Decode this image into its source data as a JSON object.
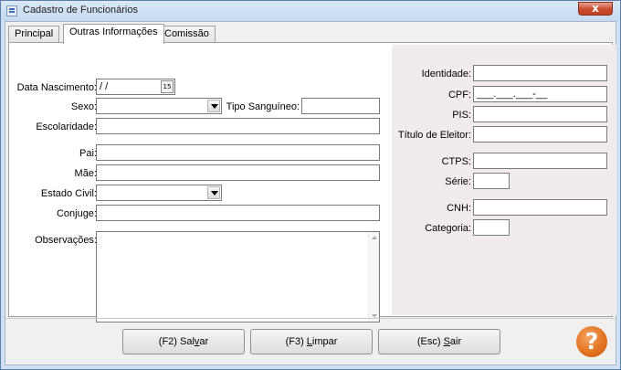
{
  "window": {
    "title": "Cadastro de Funcionários",
    "close_symbol": "x"
  },
  "tabs": [
    {
      "label": "Principal"
    },
    {
      "label": "Outras Informações",
      "active": true
    },
    {
      "label": "Comissão"
    }
  ],
  "form": {
    "data_nascimento": {
      "label": "Data Nascimento:",
      "value": " /  /",
      "calendar_glyph": "15"
    },
    "sexo": {
      "label": "Sexo:",
      "value": ""
    },
    "tipo_sanguineo": {
      "label": "Tipo Sanguíneo:",
      "value": ""
    },
    "escolaridade": {
      "label": "Escolaridade:",
      "value": ""
    },
    "pai": {
      "label": "Pai:",
      "value": ""
    },
    "mae": {
      "label": "Mãe:",
      "value": ""
    },
    "estado_civil": {
      "label": "Estado Civil:",
      "value": ""
    },
    "conjuge": {
      "label": "Conjuge:",
      "value": ""
    },
    "observacoes": {
      "label": "Observações:",
      "value": ""
    }
  },
  "docs": {
    "identidade": {
      "label": "Identidade:",
      "value": ""
    },
    "cpf": {
      "label": "CPF:",
      "value": "___.___.___-__"
    },
    "pis": {
      "label": "PIS:",
      "value": ""
    },
    "titulo_eleitor": {
      "label": "Título de Eleitor:",
      "value": ""
    },
    "ctps": {
      "label": "CTPS:",
      "value": ""
    },
    "serie": {
      "label": "Série:",
      "value": ""
    },
    "cnh": {
      "label": "CNH:",
      "value": ""
    },
    "categoria": {
      "label": "Categoria:",
      "value": ""
    }
  },
  "buttons": {
    "salvar": {
      "prefix": "(F2) Sal",
      "underlined": "v",
      "suffix": "ar"
    },
    "limpar": {
      "prefix": "(F3) ",
      "underlined": "L",
      "suffix": "impar"
    },
    "sair": {
      "prefix": "(Esc) ",
      "underlined": "S",
      "suffix": "air"
    },
    "help_symbol": "?"
  },
  "colors": {
    "help_orange": "#e07020",
    "right_panel": "#f1ebee"
  }
}
